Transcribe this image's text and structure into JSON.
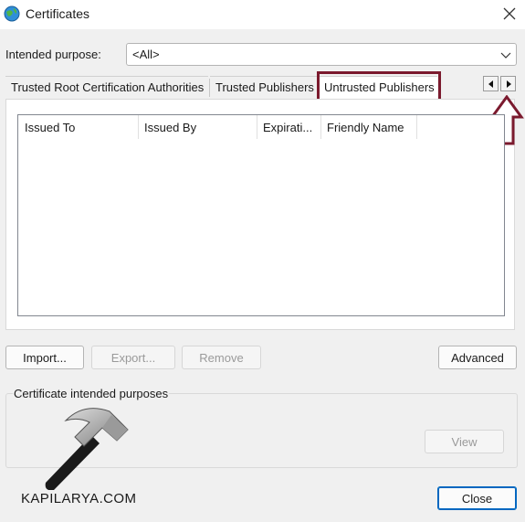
{
  "window": {
    "title": "Certificates"
  },
  "purpose": {
    "label": "Intended purpose:",
    "value": "<All>"
  },
  "tabs": [
    {
      "label": "Trusted Root Certification Authorities"
    },
    {
      "label": "Trusted Publishers"
    },
    {
      "label": "Untrusted Publishers"
    }
  ],
  "list": {
    "columns": [
      "Issued To",
      "Issued By",
      "Expirati...",
      "Friendly Name"
    ]
  },
  "buttons": {
    "import": "Import...",
    "export": "Export...",
    "remove": "Remove",
    "advanced": "Advanced",
    "view": "View",
    "close": "Close"
  },
  "purposes_group": {
    "label": "Certificate intended purposes"
  },
  "watermark": {
    "text": "KAPILARYA.COM"
  },
  "colors": {
    "highlight": "#7b1a2e",
    "focus": "#0067c0"
  },
  "icons": [
    "certificate-globe-icon",
    "close-icon",
    "chevron-down-icon",
    "scroll-left-icon",
    "scroll-right-icon",
    "up-arrow-annotation-icon",
    "hammer-logo-icon"
  ]
}
